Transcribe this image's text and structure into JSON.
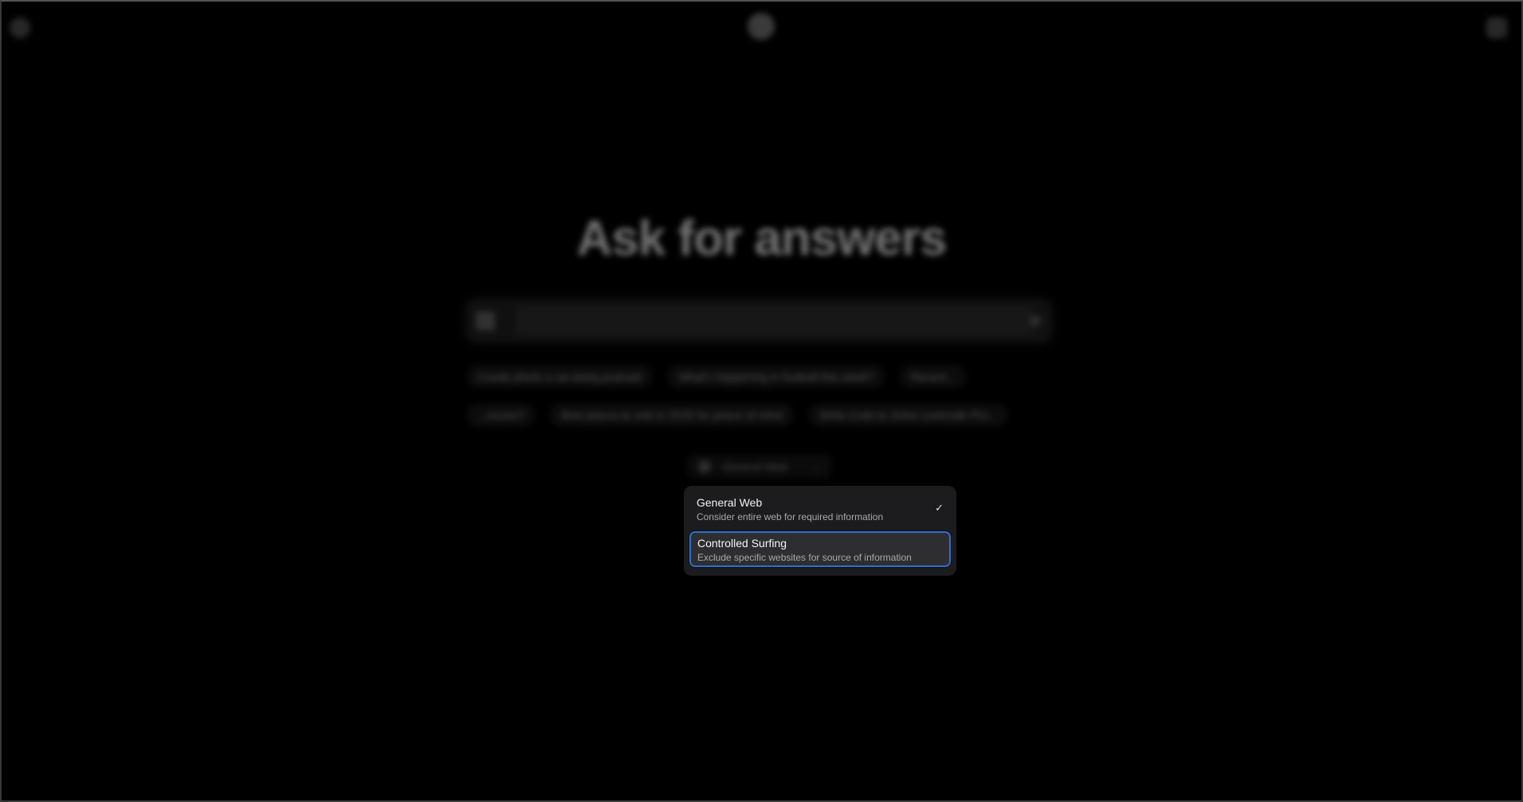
{
  "header": {
    "left_icon": "menu-icon",
    "logo_icon": "app-logo-icon",
    "right_icon": "panel-icon"
  },
  "hero": {
    "title": "Ask for answers"
  },
  "search": {
    "placeholder": "",
    "attach_icon": "image-attach-icon",
    "send_icon": "send-icon"
  },
  "suggestions": {
    "row1": [
      "Create photo a cat doing podcast",
      "What's happening in football this week?",
      "Recent..."
    ],
    "row2": [
      "...issues?",
      "Best places to visit in 2025 for peace of mind",
      "Write Code to Solve Leetcode Pro..."
    ]
  },
  "source_selector": {
    "selected": "General Web",
    "icon": "globe-icon"
  },
  "dropdown": {
    "options": [
      {
        "title": "General Web",
        "description": "Consider entire web for required information",
        "checked": true
      },
      {
        "title": "Controlled Surfing",
        "description": "Exclude specific websites for source of information",
        "checked": false,
        "highlighted": true
      }
    ],
    "highlight_color": "#2f6fd3"
  }
}
